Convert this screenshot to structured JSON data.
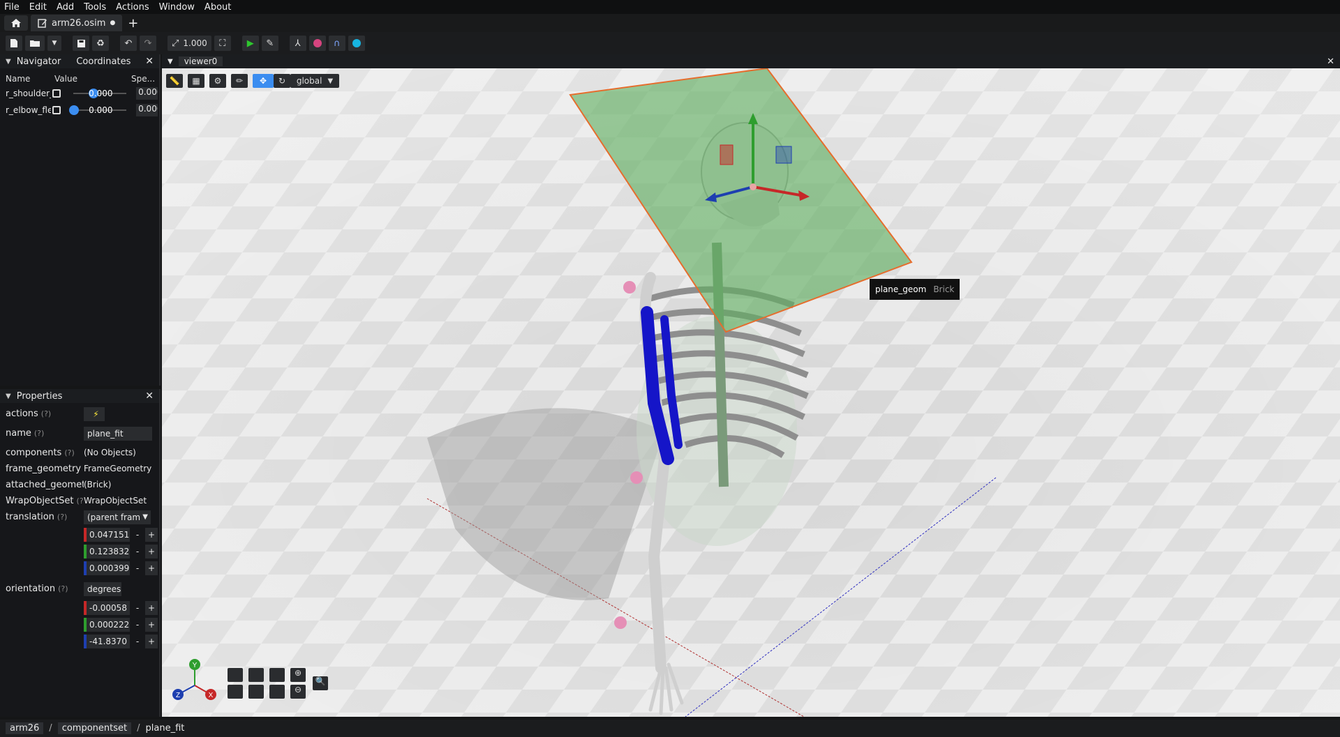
{
  "menubar": {
    "items": [
      "File",
      "Edit",
      "Add",
      "Tools",
      "Actions",
      "Window",
      "About"
    ]
  },
  "tabs": {
    "file_tab": {
      "label": "arm26.osim",
      "modified_marker": "●"
    },
    "add": "+"
  },
  "toolbar": {
    "scale_value": "1.000"
  },
  "navigator": {
    "tab_navigator": "Navigator",
    "tab_coordinates": "Coordinates",
    "columns": [
      "Name",
      "Value",
      "Spe..."
    ],
    "rows": [
      {
        "name": "r_shoulder_",
        "value": "0.000",
        "value_fraction": 0.5,
        "speed": "0.000"
      },
      {
        "name": "r_elbow_fle",
        "value": "0.000",
        "value_fraction": 0.0,
        "speed": "0.000"
      }
    ]
  },
  "properties": {
    "title": "Properties",
    "help": "(?)",
    "actions_label": "actions",
    "name_label": "name",
    "name_value": "plane_fit",
    "components_label": "components",
    "components_value": "(No Objects)",
    "frame_geometry_label": "frame_geometry",
    "frame_geometry_value": "FrameGeometry",
    "attached_label": "attached_geomet",
    "attached_value": "(Brick)",
    "wrap_label": "WrapObjectSet",
    "wrap_value": "WrapObjectSet",
    "translation_label": "translation",
    "translation_frame": "(parent fram",
    "translation": [
      "0.047151",
      "0.123832",
      "0.000399"
    ],
    "orientation_label": "orientation",
    "orientation_unit": "degrees",
    "orientation": [
      "-0.00058",
      "0.000222",
      "-41.8370"
    ]
  },
  "viewer": {
    "tab_label": "viewer0",
    "frame_mode": "global",
    "tooltip_name": "plane_geom",
    "tooltip_kind": "Brick",
    "axis_labels": {
      "x": "X",
      "y": "Y",
      "z": "Z"
    }
  },
  "statusbar": {
    "crumbs": [
      "arm26",
      "componentset",
      "plane_fit"
    ],
    "separator": "/"
  },
  "colors": {
    "accent": "#3b8df0",
    "plane": "#5fae5f",
    "axis_x": "#c62828",
    "axis_y": "#2e9e2e",
    "axis_z": "#1e3fb0",
    "muscle": "#1515c8",
    "marker": "#e58fb6"
  }
}
